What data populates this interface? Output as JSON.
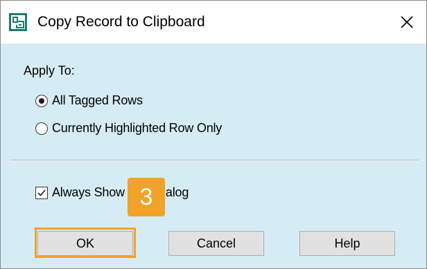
{
  "window": {
    "title": "Copy Record to Clipboard",
    "app_icon": "clipboard-app-icon",
    "close_icon": "close-icon"
  },
  "apply_to": {
    "label": "Apply To:",
    "options": [
      {
        "label": "All Tagged Rows",
        "selected": true
      },
      {
        "label": "Currently Highlighted Row Only",
        "selected": false
      }
    ]
  },
  "always_show": {
    "label": "Always Show This Dialog",
    "checked": true
  },
  "step_badge": {
    "number": "3",
    "color": "#f0a328"
  },
  "buttons": {
    "ok": "OK",
    "cancel": "Cancel",
    "help": "Help"
  },
  "colors": {
    "dialog_background": "#d6ecf4",
    "titlebar_background": "#ffffff",
    "highlight": "#f0a328"
  }
}
